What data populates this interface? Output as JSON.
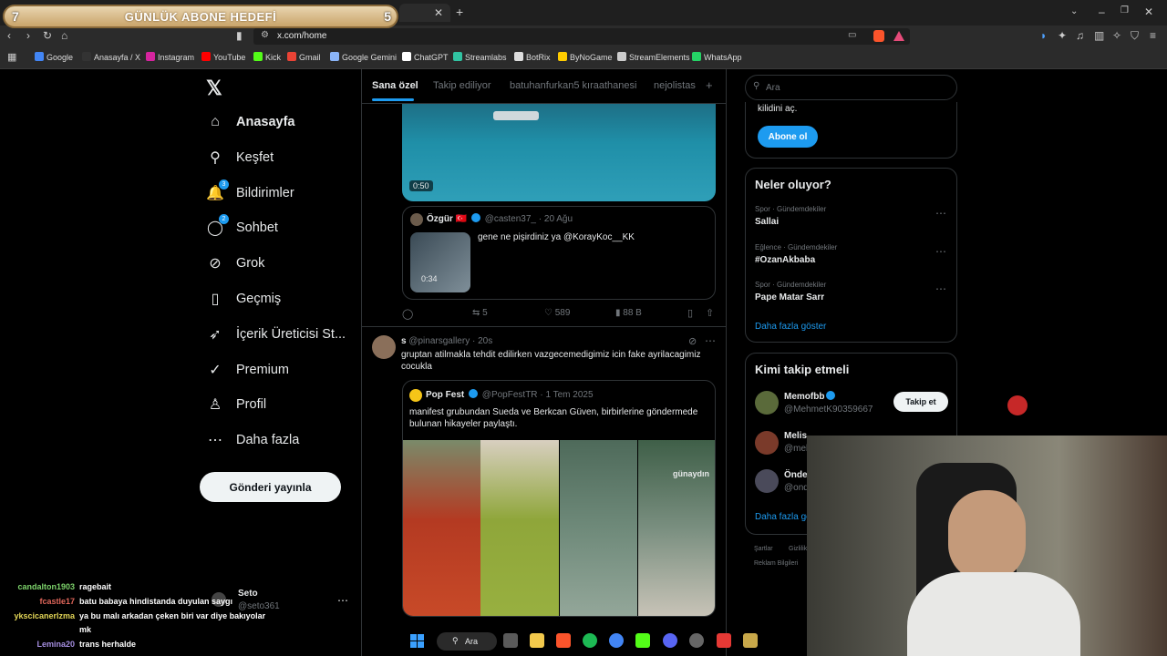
{
  "overlay": {
    "goal_left": "7",
    "goal_title": "GÜNLÜK ABONE HEDEFİ",
    "goal_right": "5"
  },
  "browser": {
    "url": "x.com/home",
    "bookmarks": [
      {
        "label": "Google",
        "color": "#4285f4"
      },
      {
        "label": "Anasayfa / X",
        "color": "#333333"
      },
      {
        "label": "Instagram",
        "color": "#d6249f"
      },
      {
        "label": "YouTube",
        "color": "#ff0000"
      },
      {
        "label": "Kick",
        "color": "#53fc18"
      },
      {
        "label": "Gmail",
        "color": "#ea4335"
      },
      {
        "label": "Google Gemini",
        "color": "#8ab4f8"
      },
      {
        "label": "ChatGPT",
        "color": "#ffffff"
      },
      {
        "label": "Streamlabs",
        "color": "#31c3a2"
      },
      {
        "label": "BotRix",
        "color": "#dddddd"
      },
      {
        "label": "ByNoGame",
        "color": "#ffcc00"
      },
      {
        "label": "StreamElements",
        "color": "#cccccc"
      },
      {
        "label": "WhatsApp",
        "color": "#25d366"
      }
    ]
  },
  "nav": {
    "items": [
      {
        "label": "Anasayfa",
        "icon": "home-icon",
        "glyph": "⌂",
        "badge": ""
      },
      {
        "label": "Keşfet",
        "icon": "search-icon",
        "glyph": "⚲",
        "badge": ""
      },
      {
        "label": "Bildirimler",
        "icon": "bell-icon",
        "glyph": "🔔",
        "badge": "3"
      },
      {
        "label": "Sohbet",
        "icon": "chat-icon",
        "glyph": "◯",
        "badge": "2"
      },
      {
        "label": "Grok",
        "icon": "grok-icon",
        "glyph": "⊘",
        "badge": ""
      },
      {
        "label": "Geçmiş",
        "icon": "bookmark-icon",
        "glyph": "▯",
        "badge": ""
      },
      {
        "label": "İçerik Üreticisi St...",
        "icon": "rocket-icon",
        "glyph": "➶",
        "badge": ""
      },
      {
        "label": "Premium",
        "icon": "premium-icon",
        "glyph": "✓",
        "badge": ""
      },
      {
        "label": "Profil",
        "icon": "profile-icon",
        "glyph": "♙",
        "badge": ""
      },
      {
        "label": "Daha fazla",
        "icon": "more-icon",
        "glyph": "⋯",
        "badge": ""
      }
    ],
    "post_button": "Gönderi yayınla",
    "account_name": "Seto",
    "account_handle": "@seto361"
  },
  "feed": {
    "tabs": [
      "Sana özel",
      "Takip ediliyor",
      "batuhanfurkan5 kıraathanesi",
      "nejolistas"
    ],
    "post1": {
      "video_duration": "0:50",
      "quote_author": "Özgür",
      "quote_flag": "🇹🇷",
      "quote_handle": "@casten37_",
      "quote_date": "20 Ağu",
      "quote_text": "gene ne pişirdiniz ya @KorayKoc__KK",
      "quote_video_duration": "0:34",
      "reposts": "5",
      "likes": "589",
      "views": "88 B"
    },
    "post2": {
      "author": "s",
      "handle": "@pinarsgallery",
      "time": "20s",
      "text": "gruptan atilmakla tehdit edilirken vazgecemedigimiz icin fake ayrilacagimiz cocukla",
      "quote_author": "Pop Fest",
      "quote_handle": "@PopFestTR",
      "quote_date": "1 Tem 2025",
      "quote_text": "manifest grubundan Sueda ve Berkcan Güven, birbirlerine göndermede bulunan hikayeler paylaştı.",
      "image_caption": "günaydın"
    }
  },
  "sidebar": {
    "search_placeholder": "Ara",
    "premium_tail": "kilidini aç.",
    "subscribe_button": "Abone ol",
    "trends_title": "Neler oluyor?",
    "trends": [
      {
        "category": "Spor · Gündemdekiler",
        "name": "Sallai"
      },
      {
        "category": "Eğlence · Gündemdekiler",
        "name": "#OzanAkbaba"
      },
      {
        "category": "Spor · Gündemdekiler",
        "name": "Pape Matar Sarr"
      }
    ],
    "trends_more": "Daha fazla göster",
    "follow_title": "Kimi takip etmeli",
    "suggestions": [
      {
        "name": "Memofbb",
        "handle": "@MehmetK90359667",
        "button": "Takip et"
      },
      {
        "name": "Melis",
        "handle": "@mel"
      },
      {
        "name": "Önde",
        "handle": "@ond"
      }
    ],
    "follow_more": "Daha fazla gö",
    "footer": [
      "Şartlar",
      "Gizlilik",
      "Reklam Bilgileri"
    ]
  },
  "chat": [
    {
      "user": "candalton1903",
      "color": "#7dd36b",
      "msg": "ragebait"
    },
    {
      "user": "fcastle17",
      "color": "#e0665a",
      "msg": "batu babaya hindistanda duyulan saygı"
    },
    {
      "user": "ykscicanerlzma",
      "color": "#e3d657",
      "msg": "ya bu malı arkadan çeken biri var diye bakıyolar"
    },
    {
      "user": "",
      "color": "#ffffff",
      "msg": "mk"
    },
    {
      "user": "Lemina20",
      "color": "#a58ee0",
      "msg": "trans herhalde"
    }
  ],
  "taskbar": {
    "search_label": "Ara"
  }
}
